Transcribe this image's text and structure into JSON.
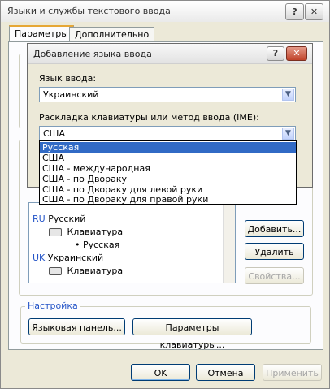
{
  "outer": {
    "title": "Языки и службы текстового ввода",
    "help": "?",
    "close": "✕",
    "tabs": [
      {
        "label": "Параметры",
        "active": true
      },
      {
        "label": "Дополнительно",
        "active": false
      }
    ],
    "tree": {
      "rows": [
        {
          "code": "RU",
          "label": "Русский"
        },
        {
          "label": "Клавиатура"
        },
        {
          "label": "• Русская"
        },
        {
          "code": "UK",
          "label": "Украинский"
        },
        {
          "label": "Клавиатура"
        }
      ]
    },
    "side_buttons": {
      "add": "Добавить...",
      "remove": "Удалить",
      "properties": "Свойства..."
    },
    "settings": {
      "legend": "Настройка",
      "language_bar": "Языковая панель...",
      "keyboard_params": "Параметры клавиатуры..."
    },
    "footer": {
      "ok": "OK",
      "cancel": "Отмена",
      "apply": "Применить"
    }
  },
  "inner": {
    "title": "Добавление языка ввода",
    "help": "?",
    "close": "✕",
    "input_language_label": "Язык ввода:",
    "input_language_value": "Украинский",
    "layout_label": "Раскладка клавиатуры или метод ввода (IME):",
    "layout_value": "США",
    "options": [
      {
        "label": "Русская",
        "selected": true
      },
      {
        "label": "США",
        "selected": false
      },
      {
        "label": "США - международная",
        "selected": false
      },
      {
        "label": "США - по Двораку",
        "selected": false
      },
      {
        "label": "США - по Двораку для левой руки",
        "selected": false
      },
      {
        "label": "США - по Двораку для правой руки",
        "selected": false
      }
    ]
  }
}
